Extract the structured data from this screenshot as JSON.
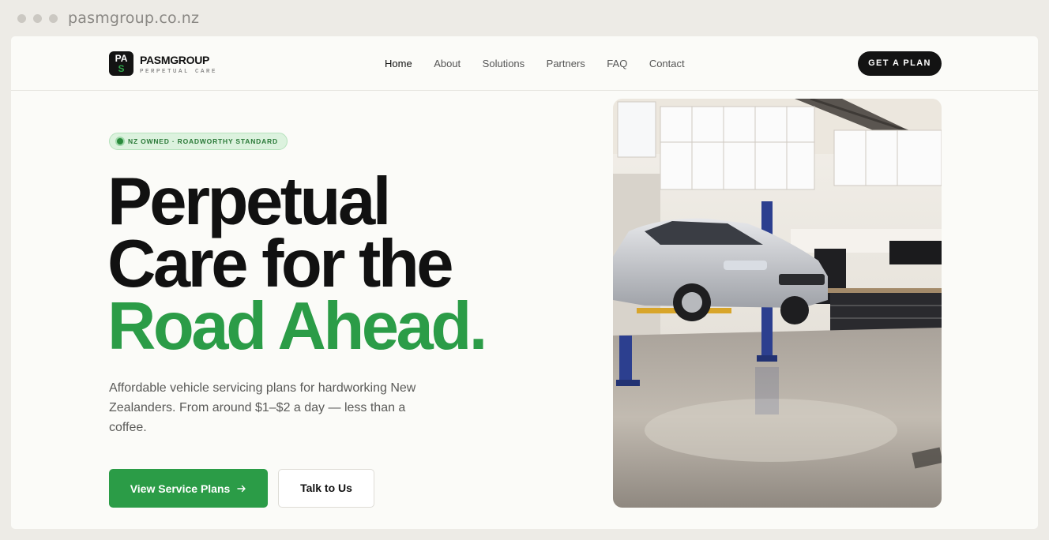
{
  "browser": {
    "url": "pasmgroup.co.nz"
  },
  "nav": {
    "logo_top": "PA",
    "logo_bottom": "S",
    "brand_name": "PASMGROUP",
    "brand_tagline": "PERPETUAL CARE",
    "links": [
      "Home",
      "About",
      "Solutions",
      "Partners",
      "FAQ",
      "Contact"
    ],
    "active": "Home",
    "cta_label": "GET A PLAN"
  },
  "hero": {
    "badge": "NZ OWNED · ROADWORTHY STANDARD",
    "headline": [
      "Perpetual",
      "Care for the",
      "Road Ahead."
    ],
    "subtitle": "Affordable vehicle servicing plans for hardworking New Zealanders. From around $1–$2 a day — less than a coffee.",
    "primary_button": "View Service Plans",
    "secondary_button": "Talk to Us"
  },
  "colors": {
    "brand_green": "#2b9c47",
    "dark": "#131313"
  }
}
